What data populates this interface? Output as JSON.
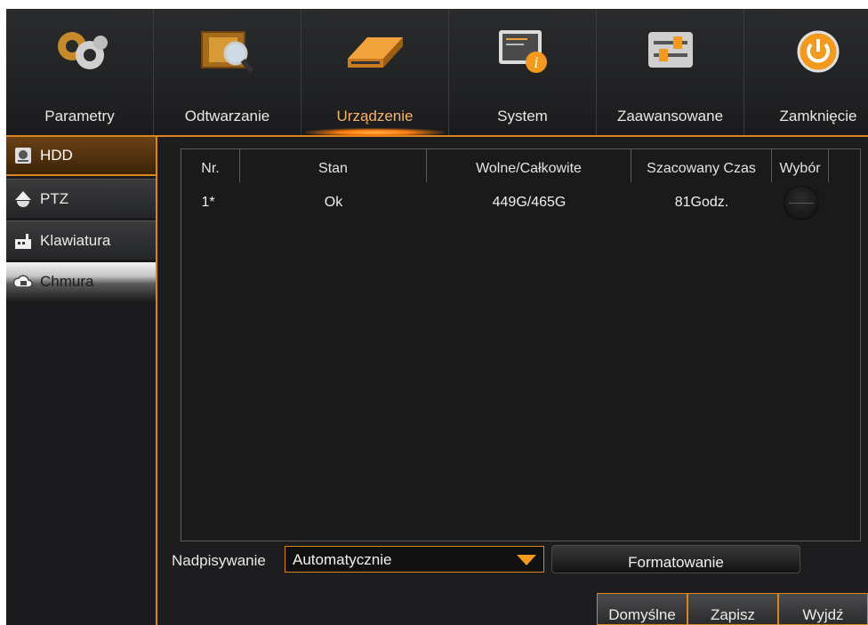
{
  "nav": {
    "tabs": [
      {
        "label": "Parametry",
        "icon": "gears-icon"
      },
      {
        "label": "Odtwarzanie",
        "icon": "film-search-icon"
      },
      {
        "label": "Urządzenie",
        "icon": "hdd-device-icon",
        "active": true
      },
      {
        "label": "System",
        "icon": "system-info-icon"
      },
      {
        "label": "Zaawansowane",
        "icon": "sliders-icon"
      },
      {
        "label": "Zamknięcie",
        "icon": "power-icon"
      }
    ]
  },
  "sidebar": {
    "items": [
      {
        "label": "HDD",
        "icon": "hdd-icon",
        "active": true
      },
      {
        "label": "PTZ",
        "icon": "camera-dome-icon"
      },
      {
        "label": "Klawiatura",
        "icon": "keyboard-icon"
      },
      {
        "label": "Chmura",
        "icon": "cloud-icon"
      }
    ]
  },
  "table": {
    "columns": [
      "Nr.",
      "Stan",
      "Wolne/Całkowite",
      "Szacowany Czas",
      "Wybór"
    ],
    "rows": [
      {
        "nr": "1*",
        "stan": "Ok",
        "space": "449G/465G",
        "time": "81Godz."
      }
    ]
  },
  "overwrite": {
    "label": "Nadpisywanie",
    "value": "Automatycznie"
  },
  "format_button": "Formatowanie",
  "footer": {
    "default": "Domyślne",
    "save": "Zapisz",
    "exit": "Wyjdź"
  },
  "colors": {
    "accent": "#d9861f",
    "background": "#1d1d1f"
  }
}
